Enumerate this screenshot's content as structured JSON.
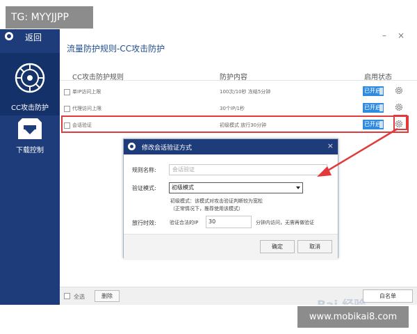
{
  "tag_top_left": "TG: MYYJJPP",
  "tag_bottom_right": "www.mobikai8.com",
  "watermark": "Bai 经验",
  "colors": {
    "sidebar": "#1d3c79",
    "toggle_on": "#2f8be0",
    "highlight_red": "#e23a3a",
    "title": "#1f4d8f"
  },
  "sidebar": {
    "back_label": "返回",
    "items": [
      {
        "label": "CC攻击防护",
        "icon": "cc-shield-icon",
        "active": true
      },
      {
        "label": "下载控制",
        "icon": "download-box-icon",
        "active": false
      }
    ]
  },
  "header": {
    "title": "流量防护规则-CC攻击防护",
    "minimize": "–",
    "close": "×"
  },
  "table": {
    "columns": [
      "CC攻击防护规则",
      "防护内容",
      "启用状态"
    ],
    "rows": [
      {
        "name": "单IP访问上限",
        "content": "100次/10秒  冻结5分钟",
        "status": "已开启"
      },
      {
        "name": "代理访问上限",
        "content": "30个IP/1秒",
        "status": "已开启"
      },
      {
        "name": "会话验证",
        "content": "初级模式  放行30分钟",
        "status": "已开启"
      }
    ]
  },
  "dialog": {
    "title": "修改会话验证方式",
    "close": "×",
    "rule_name_label": "规则名称:",
    "rule_name_placeholder": "会话验证",
    "mode_label": "验证模式:",
    "mode_value": "初级模式",
    "note_line1": "初级模式：该模式对攻击验证判断较为宽松",
    "note_line2": "（正常情况下，推荐使用该模式）",
    "release_label": "放行时效:",
    "release_prefix": "验证合法的IP",
    "release_value": "30",
    "release_suffix": "分钟内访问，无需再做验证",
    "ok_label": "确定",
    "cancel_label": "取消"
  },
  "footer": {
    "select_all": "全选",
    "delete": "删除",
    "whitelist": "白名单"
  }
}
